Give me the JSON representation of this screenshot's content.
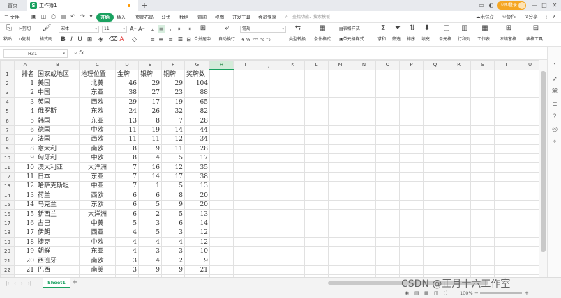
{
  "tabs": {
    "home": "首页",
    "workbook": "工作簿1",
    "new_tab": "+"
  },
  "login": {
    "label": "立即登录"
  },
  "menu": {
    "file": "三 文件",
    "items": [
      "开始",
      "插入",
      "页面布局",
      "公式",
      "数据",
      "审阅",
      "视图",
      "开发工具",
      "会员专享"
    ],
    "search_placeholder": "查找功能、搜索模板",
    "right": {
      "unsaved": "未保存",
      "collab": "协作",
      "share": "分享"
    }
  },
  "ribbon": {
    "paste": "粘贴",
    "cut": "剪切",
    "copy": "复制",
    "format_painter": "格式刷",
    "font_name": "宋体",
    "font_size": "11",
    "merge_center": "合并居中",
    "wrap": "自动换行",
    "number_format": "常规",
    "convert": "类型转换",
    "cond_format": "条件格式",
    "table_style": "表格样式",
    "cell_style": "单元格样式",
    "sum": "求和",
    "filter": "筛选",
    "sort": "排序",
    "fill": "填充",
    "cell": "单元格",
    "row_col": "行和列",
    "worksheet": "工作表",
    "freeze": "冻结窗格",
    "table_tools": "表格工具"
  },
  "formula_bar": {
    "name_box": "H31",
    "fx": "fx",
    "formula": ""
  },
  "grid": {
    "columns": [
      "A",
      "B",
      "C",
      "D",
      "E",
      "F",
      "G",
      "H",
      "I",
      "J",
      "K",
      "L",
      "M",
      "N",
      "O",
      "P",
      "Q",
      "R",
      "S",
      "T",
      "U"
    ],
    "active_column": "H",
    "rows": [
      [
        "排名",
        "国家或地区",
        "地理位置",
        "金牌",
        "银牌",
        "铜牌",
        "奖牌数"
      ],
      [
        "1",
        "美国",
        "北美",
        "46",
        "29",
        "29",
        "104"
      ],
      [
        "2",
        "中国",
        "东亚",
        "38",
        "27",
        "23",
        "88"
      ],
      [
        "3",
        "英国",
        "西欧",
        "29",
        "17",
        "19",
        "65"
      ],
      [
        "4",
        "俄罗斯",
        "东欧",
        "24",
        "26",
        "32",
        "82"
      ],
      [
        "5",
        "韩国",
        "东亚",
        "13",
        "8",
        "7",
        "28"
      ],
      [
        "6",
        "德国",
        "中欧",
        "11",
        "19",
        "14",
        "44"
      ],
      [
        "7",
        "法国",
        "西欧",
        "11",
        "11",
        "12",
        "34"
      ],
      [
        "8",
        "意大利",
        "南欧",
        "8",
        "9",
        "11",
        "28"
      ],
      [
        "9",
        "匈牙利",
        "中欧",
        "8",
        "4",
        "5",
        "17"
      ],
      [
        "10",
        "澳大利亚",
        "大洋洲",
        "7",
        "16",
        "12",
        "35"
      ],
      [
        "11",
        "日本",
        "东亚",
        "7",
        "14",
        "17",
        "38"
      ],
      [
        "12",
        "哈萨克斯坦",
        "中亚",
        "7",
        "1",
        "5",
        "13"
      ],
      [
        "13",
        "荷兰",
        "西欧",
        "6",
        "6",
        "8",
        "20"
      ],
      [
        "14",
        "乌克兰",
        "东欧",
        "6",
        "5",
        "9",
        "20"
      ],
      [
        "15",
        "新西兰",
        "大洋洲",
        "6",
        "2",
        "5",
        "13"
      ],
      [
        "16",
        "古巴",
        "中美",
        "5",
        "3",
        "6",
        "14"
      ],
      [
        "17",
        "伊朗",
        "西亚",
        "4",
        "5",
        "3",
        "12"
      ],
      [
        "18",
        "捷克",
        "中欧",
        "4",
        "4",
        "4",
        "12"
      ],
      [
        "19",
        "朝鲜",
        "东亚",
        "4",
        "3",
        "3",
        "10"
      ],
      [
        "20",
        "西班牙",
        "南欧",
        "3",
        "4",
        "2",
        "9"
      ],
      [
        "21",
        "巴西",
        "南美",
        "3",
        "9",
        "9",
        "21"
      ],
      [
        "",
        "",
        "",
        "",
        "",
        "",
        ""
      ]
    ]
  },
  "sheets": {
    "active": "Sheet1",
    "add": "+"
  },
  "status": {
    "zoom": "100%"
  },
  "watermark": "CSDN @正月十六工作室",
  "colors": {
    "accent": "#1aa260",
    "login": "#f5a623"
  }
}
